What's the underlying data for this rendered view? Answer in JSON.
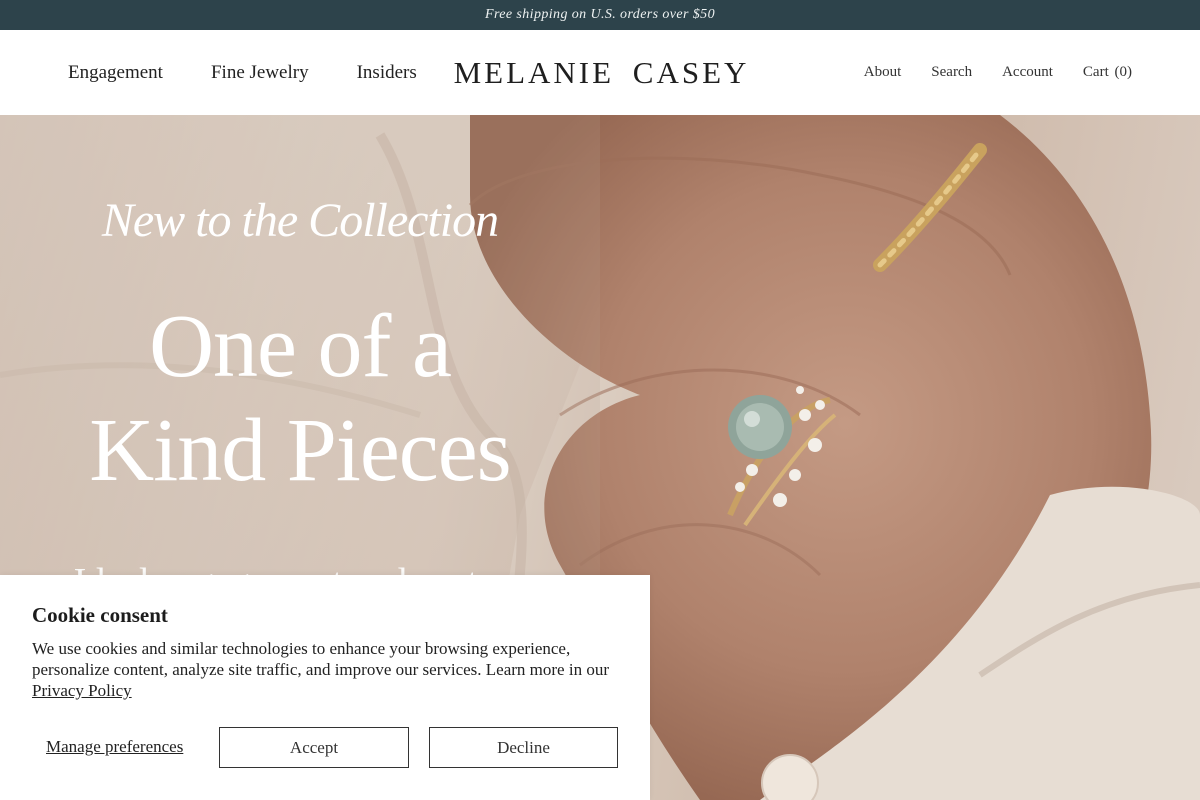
{
  "announcement": "Free shipping on U.S. orders over $50",
  "header": {
    "nav_left": [
      "Engagement",
      "Fine Jewelry",
      "Insiders"
    ],
    "logo": "MELANIE CASEY",
    "nav_right": {
      "about": "About",
      "search": "Search",
      "account": "Account",
      "cart_label": "Cart",
      "cart_count": "(0)"
    }
  },
  "hero": {
    "eyebrow": "New to the Collection",
    "title_line1": "One of a",
    "title_line2": "Kind Pieces",
    "subtitle": "Ideal engagement and custom rings, one of a kind"
  },
  "cookie": {
    "title": "Cookie consent",
    "text": "We use cookies and similar technologies to enhance your browsing experience, personalize content, analyze site traffic, and improve our services. Learn more in our ",
    "link": "Privacy Policy",
    "manage": "Manage preferences",
    "accept": "Accept",
    "decline": "Decline"
  },
  "colors": {
    "announcement_bg": "#2d434b",
    "header_bg": "#ffffff",
    "hero_text": "#ffffff"
  }
}
